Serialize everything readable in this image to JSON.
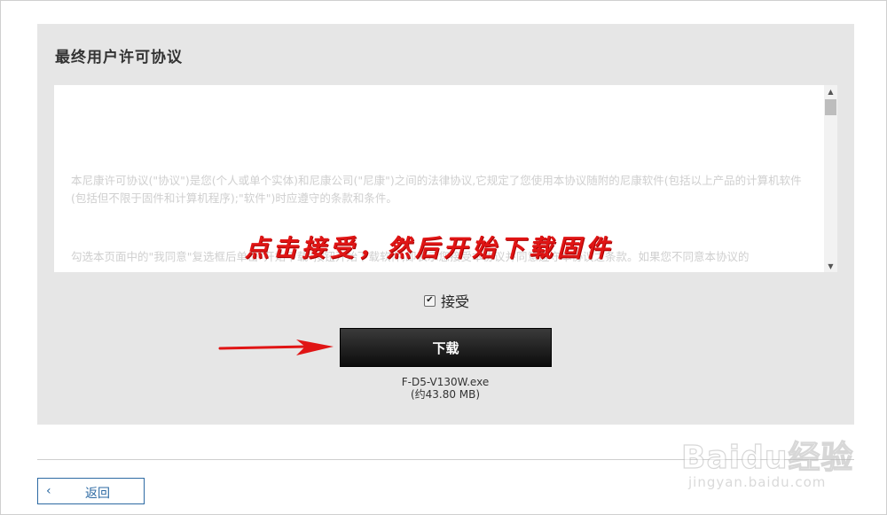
{
  "panel": {
    "title": "最终用户许可协议"
  },
  "eula": {
    "paragraphs": [
      "本尼康许可协议(\"协议\")是您(个人或单个实体)和尼康公司(\"尼康\")之间的法律协议,它规定了您使用本协议随附的尼康软件(包括以上产品的计算机软件(包括但不限于固件和计算机程序);\"软件\")时应遵守的条款和条件。",
      "勾选本页面中的\"我同意\"复选框后单击\"开始下载\"按钮开始下载软件,即表示您接受本协议并同意遵守本协议之条款。如果您不同意本协议的"
    ]
  },
  "annotation": {
    "text": "点击接受，然后开始下载固件"
  },
  "accept": {
    "label": "接受",
    "checked": true,
    "check_glyph": "✔"
  },
  "download": {
    "button_label": "下载",
    "file_name": "F-D5-V130W.exe",
    "file_size": "(约43.80 MB)"
  },
  "back": {
    "chevron": "‹",
    "label": "返回"
  },
  "scrollbar": {
    "up_glyph": "▲",
    "down_glyph": "▼"
  },
  "watermark": {
    "brand": "Baidu经验",
    "url": "jingyan.baidu.com"
  },
  "colors": {
    "panel_bg": "#e6e6e6",
    "annotation_red": "#e01515",
    "button_black": "#111111",
    "link_blue": "#2d6aa3"
  }
}
